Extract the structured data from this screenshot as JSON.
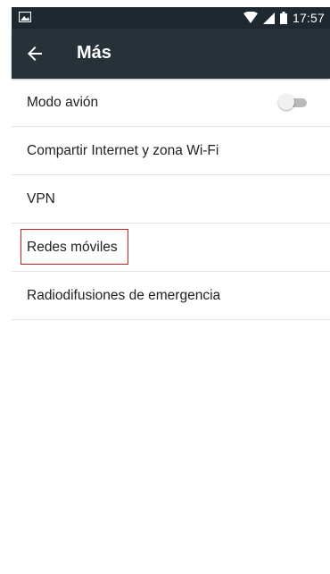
{
  "status_bar": {
    "time": "17:57",
    "icons": [
      "image-notification-icon",
      "wifi-icon",
      "cell-signal-icon",
      "battery-icon"
    ]
  },
  "app_bar": {
    "title": "Más",
    "back_icon": "arrow-back-icon",
    "background": "#263238"
  },
  "settings": {
    "items": [
      {
        "label": "Modo avión",
        "toggle": false
      },
      {
        "label": "Compartir Internet y zona Wi-Fi"
      },
      {
        "label": "VPN"
      },
      {
        "label": "Redes móviles",
        "highlighted": true
      },
      {
        "label": "Radiodifusiones de emergencia"
      }
    ]
  },
  "colors": {
    "status_bar": "#1e2830",
    "highlight_box": "#cc2020",
    "text": "#212121"
  }
}
